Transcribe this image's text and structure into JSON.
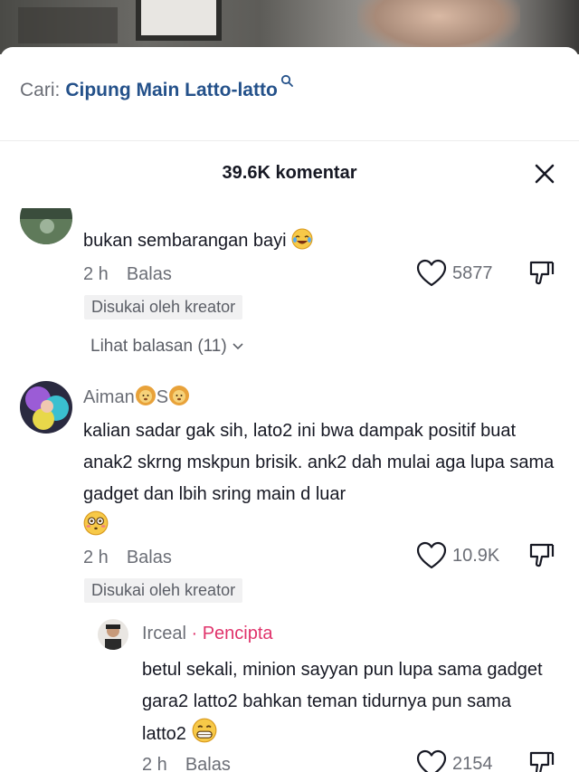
{
  "search": {
    "prefix": "Cari:",
    "query": "Cipung Main Latto-latto"
  },
  "header": {
    "count_title": "39.6K komentar"
  },
  "comments": [
    {
      "text": "bukan sembarangan bayi",
      "time": "2 h",
      "reply_label": "Balas",
      "likes": "5877",
      "badge": "Disukai oleh kreator",
      "view_replies": "Lihat balasan (11)"
    },
    {
      "author": "Aiman",
      "author_mid": "S",
      "text": "kalian sadar gak sih, lato2 ini bwa dampak positif buat anak2 skrng mskpun brisik. ank2 dah mulai aga lupa sama gadget dan lbih sring main d luar",
      "time": "2 h",
      "reply_label": "Balas",
      "likes": "10.9K",
      "badge": "Disukai oleh kreator"
    },
    {
      "author": "Irceal",
      "separator": " · ",
      "creator_label": "Pencipta",
      "text": "betul sekali, minion sayyan pun lupa sama gadget gara2 latto2 bahkan teman tidurnya pun sama latto2",
      "time": "2 h",
      "reply_label": "Balas",
      "likes": "2154"
    }
  ],
  "colors": {
    "query": "#24518a",
    "creator": "#e0336b",
    "muted": "#6b6e76",
    "badge_bg": "#f1f1f2"
  },
  "icons": [
    "search-icon",
    "close-icon",
    "heart-icon",
    "dislike-icon",
    "chevron-down-icon",
    "laughing-emoji",
    "flushed-emoji",
    "grinning-emoji",
    "lion-emoji"
  ]
}
